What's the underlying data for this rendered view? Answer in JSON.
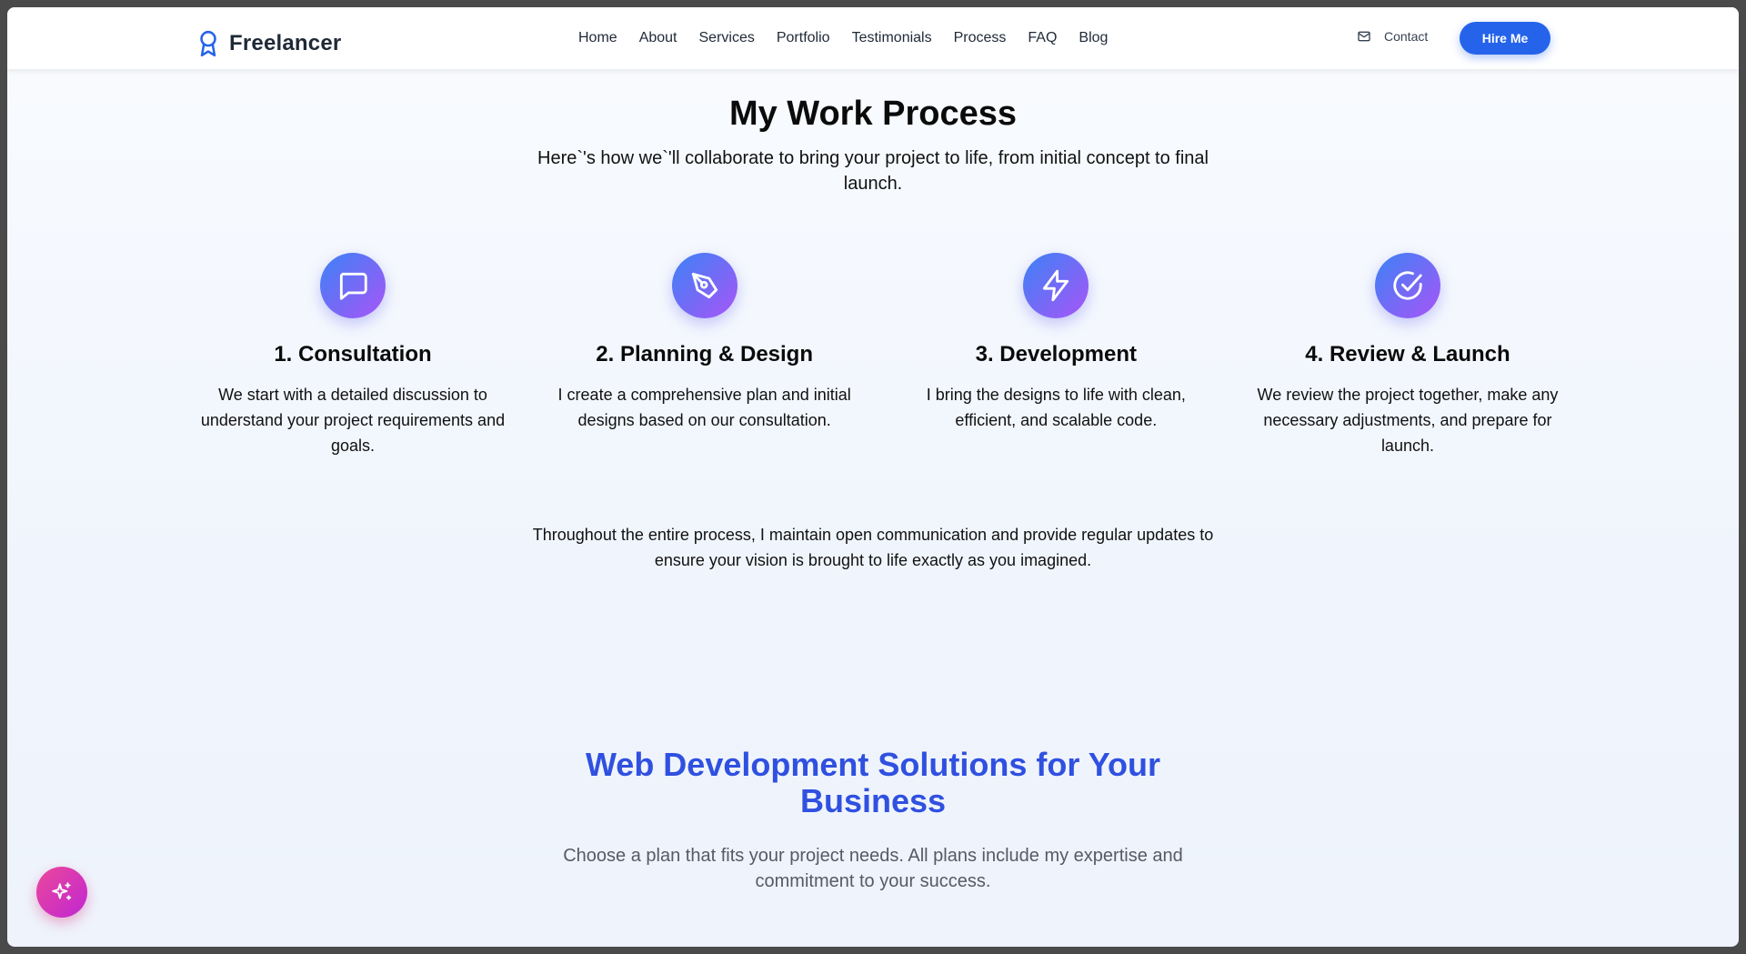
{
  "nav": {
    "brand": "Freelancer",
    "brand_icon": "award-ribbon-icon",
    "items": [
      {
        "label": "Home"
      },
      {
        "label": "About"
      },
      {
        "label": "Services"
      },
      {
        "label": "Portfolio"
      },
      {
        "label": "Testimonials"
      },
      {
        "label": "Process"
      },
      {
        "label": "FAQ"
      },
      {
        "label": "Blog"
      }
    ],
    "contact_label": "Contact",
    "contact_icon": "mail-icon",
    "hire_label": "Hire Me"
  },
  "process": {
    "title": "My Work Process",
    "subtitle": "Here`'s how we`'ll collaborate to bring your project to life, from initial concept to final launch.",
    "steps": [
      {
        "icon": "message-square-icon",
        "title": "1. Consultation",
        "text": "We start with a detailed discussion to understand your project requirements and goals."
      },
      {
        "icon": "pen-tool-icon",
        "title": "2. Planning & Design",
        "text": "I create a comprehensive plan and initial designs based on our consultation."
      },
      {
        "icon": "zap-icon",
        "title": "3. Development",
        "text": "I bring the designs to life with clean, efficient, and scalable code."
      },
      {
        "icon": "check-circle-icon",
        "title": "4. Review & Launch",
        "text": "We review the project together, make any necessary adjustments, and prepare for launch."
      }
    ],
    "closing": "Throughout the entire process, I maintain open communication and provide regular updates to ensure your vision is brought to life exactly as you imagined."
  },
  "pricing": {
    "title": "Web Development Solutions for Your Business",
    "subtitle": "Choose a plan that fits your project needs. All plans include my expertise and commitment to your success."
  },
  "fab": {
    "icon": "sparkles-icon"
  },
  "colors": {
    "accent": "#2563eb",
    "gradient_start": "#3b82f6",
    "gradient_end": "#a855f7",
    "fab_gradient": "#ec4899"
  }
}
